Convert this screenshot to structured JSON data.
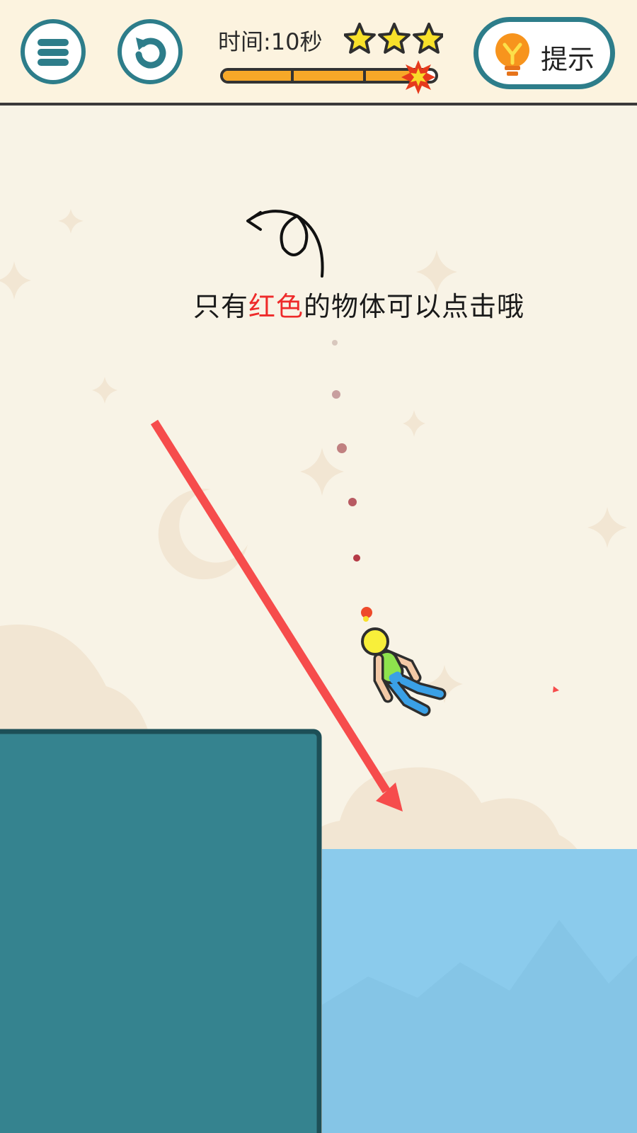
{
  "hud": {
    "menu_icon": "hamburger-menu-icon",
    "restart_icon": "restart-arrow-icon",
    "timer_text": "时间:10秒",
    "stars_earned": 3,
    "stars_total": 3,
    "progress_fraction": 0.9,
    "hint_label": "提示",
    "hint_icon": "lightbulb-icon"
  },
  "instruction": {
    "prefix": "只有",
    "highlight": "红色",
    "suffix": "的物体可以点击哦"
  },
  "colors": {
    "sky": "#f8f3e6",
    "platform": "#35838f",
    "water": "#8bcbec",
    "red_arrow": "#f64c4c",
    "accent_teal": "#2d7d8a",
    "star_yellow": "#f8e12a",
    "progress_orange": "#f7a828"
  }
}
